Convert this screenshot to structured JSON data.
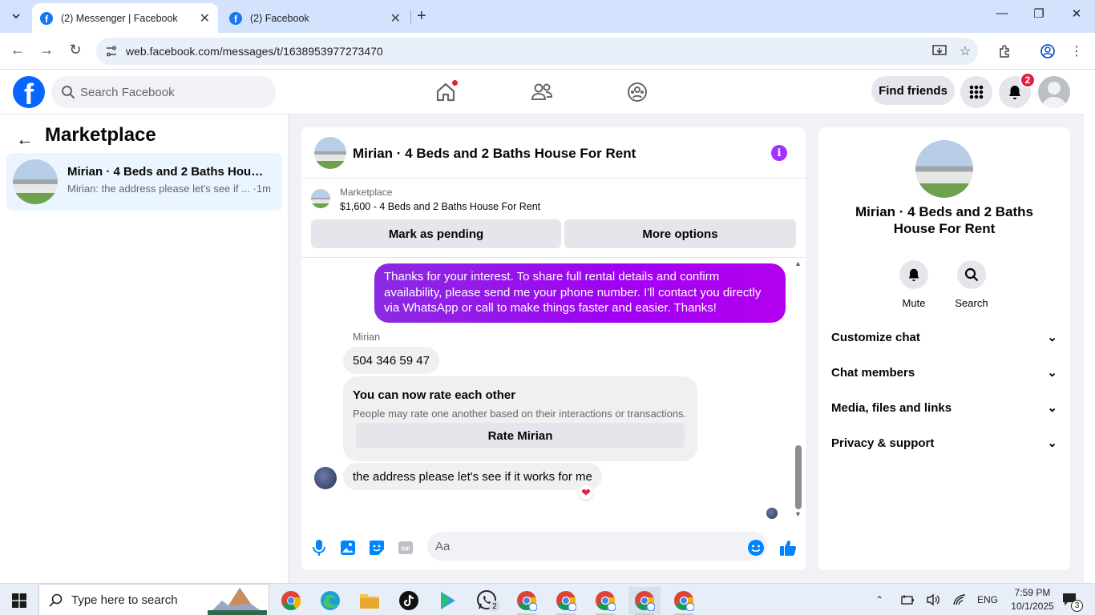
{
  "browser": {
    "tabs": [
      {
        "title": "(2) Messenger | Facebook",
        "active": true
      },
      {
        "title": "(2) Facebook",
        "active": false
      }
    ],
    "url": "web.facebook.com/messages/t/1638953977273470"
  },
  "header": {
    "search_placeholder": "Search Facebook",
    "find_friends": "Find friends",
    "notification_count": "2"
  },
  "sidebar": {
    "title": "Marketplace",
    "conversation": {
      "name": "Mirian · 4 Beds and 2 Baths House...",
      "preview": "Mirian: the address please let's see if ... ·1m"
    }
  },
  "chat": {
    "title": "Mirian · 4 Beds and 2 Baths House For Rent",
    "listing_label": "Marketplace",
    "listing_price": "$1,600 - 4 Beds and 2 Baths House For Rent",
    "mark_pending": "Mark as pending",
    "more_options": "More options",
    "messages": {
      "outgoing": "Thanks for your interest. To share full rental details and confirm availability, please send me your phone number. I'll contact you directly via WhatsApp or call to make things faster and easier. Thanks!",
      "sender_name": "Mirian",
      "phone": "504 346 59 47",
      "rate_title": "You can now rate each other",
      "rate_sub": "People may rate one another based on their interactions or transactions.",
      "rate_button": "Rate Mirian",
      "last": "the address please let's see if it works for me",
      "reaction": "❤"
    },
    "composer_placeholder": "Aa"
  },
  "info": {
    "name": "Mirian · 4 Beds and 2 Baths House For Rent",
    "actions": [
      "Mute",
      "Search"
    ],
    "sections": [
      "Customize chat",
      "Chat members",
      "Media, files and links",
      "Privacy & support"
    ]
  },
  "taskbar": {
    "search_placeholder": "Type here to search",
    "language": "ENG",
    "time": "7:59 PM",
    "date": "10/1/2025",
    "notif_count": "3",
    "whatsapp_badge": "2"
  },
  "colors": {
    "fb_blue": "#0866ff",
    "messenger_purple": "#a100f2",
    "badge_red": "#e41e3f"
  }
}
